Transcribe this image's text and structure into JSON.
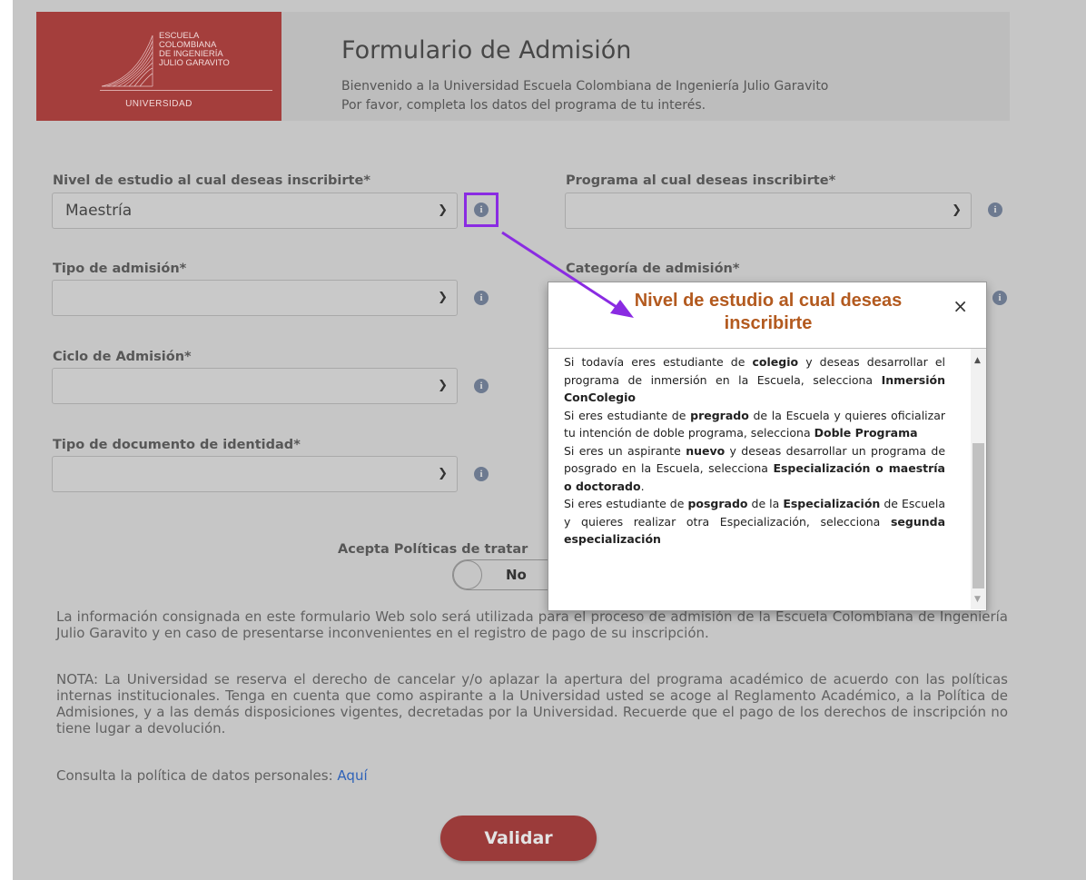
{
  "header": {
    "logo_lines": [
      "ESCUELA",
      "COLOMBIANA",
      "DE INGENIERÍA",
      "JULIO GARAVITO"
    ],
    "logo_caption": "UNIVERSIDAD",
    "title": "Formulario de Admisión",
    "subtitle_1": "Bienvenido a la Universidad Escuela Colombiana de Ingeniería Julio Garavito",
    "subtitle_2": "Por favor, completa los datos del programa de tu interés."
  },
  "form": {
    "nivel_label": "Nivel de estudio al cual deseas inscribirte*",
    "nivel_value": "Maestría",
    "programa_label": "Programa al cual deseas inscribirte*",
    "programa_value": "",
    "tipo_label": "Tipo de admisión*",
    "categoria_label": "Categoría de admisión*",
    "ciclo_label": "Ciclo de Admisión*",
    "documento_label": "Tipo de documento de identidad*",
    "politicas_label": "Acepta Políticas de tratar",
    "politicas_value": "No"
  },
  "icons": {
    "info": "info-icon",
    "chevron": "chevron-down-icon",
    "close": "close-icon"
  },
  "paragraphs": {
    "info": "La información consignada en este formulario Web solo será utilizada para el proceso de admisión de la Escuela Colombiana de Ingeniería Julio Garavito y en caso de presentarse inconvenientes en el registro de pago de su inscripción.",
    "nota": "NOTA: La Universidad se reserva el derecho de cancelar y/o aplazar la apertura del programa académico de acuerdo con las políticas internas institucionales. Tenga en cuenta que como aspirante a la Universidad usted se acoge al Reglamento Académico, a la Política de Admisiones, y a las demás disposiciones vigentes, decretadas por la Universidad. Recuerde que el pago de los derechos de inscripción no tiene lugar a devolución.",
    "consulta": "Consulta la política de datos personales: ",
    "consulta_link": "Aquí"
  },
  "button": {
    "validar": "Validar"
  },
  "modal": {
    "title": "Nivel de estudio al cual deseas inscribirte",
    "close": "×",
    "p1_a": "Si todavía eres estudiante de ",
    "p1_b": "colegio",
    "p1_c": " y deseas desarrollar el programa de inmersión en la Escuela, selecciona ",
    "p1_d": "Inmersión ConColegio",
    "p2_a": "Si eres estudiante de ",
    "p2_b": "pregrado",
    "p2_c": " de la Escuela y quieres oficializar tu intención de doble programa, selecciona ",
    "p2_d": "Doble Programa",
    "p3_a": "Si eres un aspirante ",
    "p3_b": "nuevo",
    "p3_c": " y deseas desarrollar un programa de posgrado en la Escuela, selecciona ",
    "p3_d": "Especialización o maestría o doctorado",
    "p3_e": ".",
    "p4_a": "Si eres estudiante de ",
    "p4_b": "posgrado",
    "p4_c": " de la ",
    "p4_d": "Especialización",
    "p4_e": " de Escuela y quieres realizar otra Especialización, selecciona ",
    "p4_f": "segunda especialización"
  },
  "colors": {
    "brand": "#a43e3c",
    "accent_highlight": "#8a2be2",
    "modal_title": "#b35a1f",
    "link": "#2e62b8"
  }
}
